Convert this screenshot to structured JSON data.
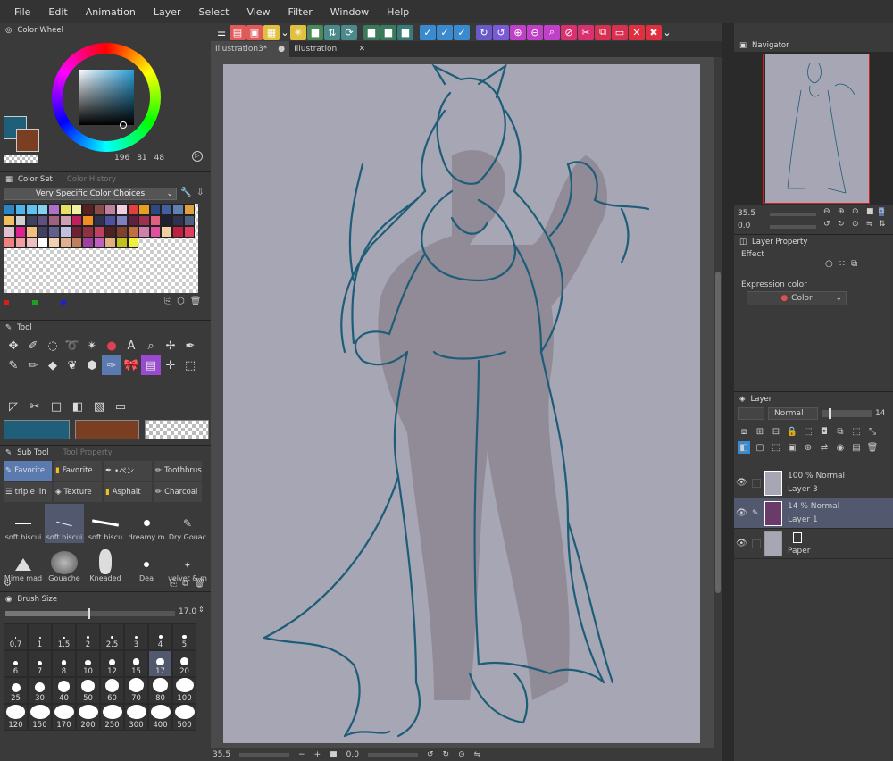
{
  "menu": [
    "File",
    "Edit",
    "Animation",
    "Layer",
    "Select",
    "View",
    "Filter",
    "Window",
    "Help"
  ],
  "tabs": [
    {
      "label": "Illustration3*"
    },
    {
      "label": "Illustration"
    }
  ],
  "color_wheel": {
    "title": "Color Wheel",
    "h": "196",
    "s": "81",
    "v": "48",
    "main_color": "#1f5f7a",
    "sub_color": "#7a3f22"
  },
  "color_set": {
    "title": "Color Set",
    "tab2": "Color History",
    "dropdown": "Very Specific Color Choices",
    "swatches": [
      "#2b86c8",
      "#4fb4e8",
      "#60c0f0",
      "#86d0f0",
      "#b070c8",
      "#e8e060",
      "#f0f0a0",
      "#5a2020",
      "#8a4a4a",
      "#c080a0",
      "#f0d0e0",
      "#e04040",
      "#e8a020",
      "#304880",
      "#4060a0",
      "#6080b0",
      "#e0a040",
      "#f0c060",
      "#d0d0d0",
      "#404060",
      "#605080",
      "#a06080",
      "#d0a0b0",
      "#c02060",
      "#f09020",
      "#303050",
      "#5050a0",
      "#8080c0",
      "#602040",
      "#a03050",
      "#e06080",
      "#202030",
      "#303050",
      "#506080",
      "#e0c0d0",
      "#e02090",
      "#f0c080",
      "#404060",
      "#606090",
      "#c0c0e0",
      "#702030",
      "#903040",
      "#c04060",
      "#502020",
      "#804030",
      "#c07040",
      "#d080b0",
      "#e050a0",
      "#f0d0a0",
      "#c02040",
      "#e04060",
      "#f08080",
      "#f0a0a0",
      "#f0c0c0",
      "#ffffff",
      "#f0d0b0",
      "#e0b090",
      "#c08060",
      "#a040a0",
      "#c060c0",
      "#e0b080",
      "#c0c020",
      "#f0f040"
    ]
  },
  "color_bottom": {
    "r": "#d02020",
    "g": "#20a020",
    "b": "#2020d0"
  },
  "tool_panel": {
    "title": "Tool"
  },
  "subtool": {
    "title": "Sub Tool",
    "tab2": "Tool Property",
    "groups": [
      "Favorite",
      "Favorite",
      "•ペン",
      "Toothbrush",
      "triple lin",
      "Texture",
      "Asphalt",
      "Charcoal"
    ],
    "brushes": [
      "soft biscui",
      "soft biscui",
      "soft biscu",
      "dreamy m",
      "Dry Gouac",
      "Mime mad",
      "Gouache",
      "Kneaded",
      "Dea",
      "velvet & m"
    ]
  },
  "brush_size": {
    "title": "Brush Size",
    "value": "17.0",
    "sizes": [
      "0.7",
      "1",
      "1.5",
      "2",
      "2.5",
      "3",
      "4",
      "5",
      "6",
      "7",
      "8",
      "10",
      "12",
      "15",
      "17",
      "20",
      "25",
      "30",
      "40",
      "50",
      "60",
      "70",
      "80",
      "100",
      "120",
      "150",
      "170",
      "200",
      "250",
      "300",
      "400",
      "500"
    ]
  },
  "navigator": {
    "title": "Navigator",
    "zoom": "35.5",
    "rotate": "0.0"
  },
  "layer_property": {
    "title": "Layer Property",
    "effect_label": "Effect",
    "expression_label": "Expression color",
    "expression_value": "Color"
  },
  "layer_panel": {
    "title": "Layer",
    "blend": "Normal",
    "opacity": "14",
    "layers": [
      {
        "opacity": "100 % Normal",
        "name": "Layer 3"
      },
      {
        "opacity": "14 % Normal",
        "name": "Layer 1"
      },
      {
        "opacity": "",
        "name": "Paper"
      }
    ]
  },
  "status": {
    "zoom": "35.5",
    "angle": "0.0"
  },
  "colors": {
    "accent": "#5b9bd5",
    "canvas": "#a7a6b4",
    "stroke": "#1d5d78",
    "panel": "#3a3a3a"
  }
}
